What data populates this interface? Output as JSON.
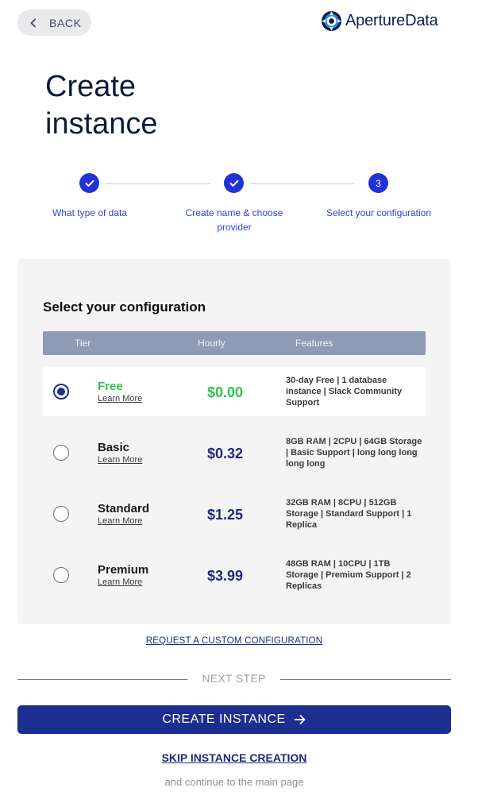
{
  "header": {
    "back_label": "BACK",
    "logo_text": "ApertureData"
  },
  "page_title": "Create instance",
  "steps": [
    {
      "label": "What type of data",
      "state": "complete",
      "marker": ""
    },
    {
      "label": "Create name & choose provider",
      "state": "complete",
      "marker": ""
    },
    {
      "label": "Select your configuration",
      "state": "current",
      "marker": "3"
    }
  ],
  "config": {
    "title": "Select your configuration",
    "columns": [
      "Tier",
      "Hourly",
      "Features"
    ],
    "tiers": [
      {
        "name": "Free",
        "learn_more": "Learn More",
        "price": "$0.00",
        "features": "30-day Free | 1 database instance | Slack Community Support",
        "selected": true
      },
      {
        "name": "Basic",
        "learn_more": "Learn More",
        "price": "$0.32",
        "features": "8GB RAM | 2CPU | 64GB Storage | Basic Support | long long long long long",
        "selected": false
      },
      {
        "name": "Standard",
        "learn_more": "Learn More",
        "price": "$1.25",
        "features": "32GB RAM | 8CPU | 512GB Storage | Standard Support | 1 Replica",
        "selected": false
      },
      {
        "name": "Premium",
        "learn_more": "Learn More",
        "price": "$3.99",
        "features": "48GB RAM | 10CPU | 1TB Storage | Premium Support | 2 Replicas",
        "selected": false
      }
    ]
  },
  "custom_config_link": "REQUEST A CUSTOM CONFIGURATION",
  "next_step_label": "NEXT STEP",
  "create_button_label": "CREATE INSTANCE",
  "skip_link": "SKIP INSTANCE CREATION",
  "continue_text": "and continue to the main page",
  "colors": {
    "primary": "#1c2e8f",
    "step_blue": "#1f33d6",
    "free_green": "#2ec34a",
    "header_gray": "#8f9ab4",
    "card_bg": "#f4f4f5"
  }
}
